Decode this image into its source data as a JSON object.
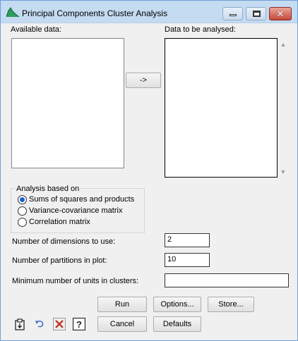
{
  "window": {
    "title": "Principal Components Cluster Analysis",
    "close_glyph": "✕",
    "minimize_icon": "minimize-icon",
    "maximize_icon": "maximize-icon",
    "close_icon": "close-icon"
  },
  "lists": {
    "available_label": "Available data:",
    "target_label": "Data to be analysed:",
    "move_button": "->",
    "scroll_up": "▲",
    "scroll_down": "▼"
  },
  "analysis": {
    "group_title": "Analysis based on",
    "options": [
      {
        "label": "Sums of squares and products",
        "selected": true
      },
      {
        "label": "Variance-covariance matrix",
        "selected": false
      },
      {
        "label": "Correlation matrix",
        "selected": false
      }
    ]
  },
  "fields": {
    "dimensions_label": "Number of dimensions to use:",
    "dimensions_value": "2",
    "partitions_label": "Number of partitions in plot:",
    "partitions_value": "10",
    "min_units_label": "Minimum number of units in clusters:",
    "min_units_value": ""
  },
  "buttons": {
    "run": "Run",
    "options": "Options...",
    "store": "Store...",
    "cancel": "Cancel",
    "defaults": "Defaults"
  },
  "toolbar_icons": [
    "paste-clipboard-icon",
    "undo-icon",
    "clear-icon",
    "help-icon"
  ],
  "colors": {
    "titlebar": "#c4dbf2",
    "close_button": "#c7483a",
    "radio_selected": "#1b5fd1",
    "clear_icon": "#c0392b",
    "undo_icon": "#3b6fc8"
  }
}
